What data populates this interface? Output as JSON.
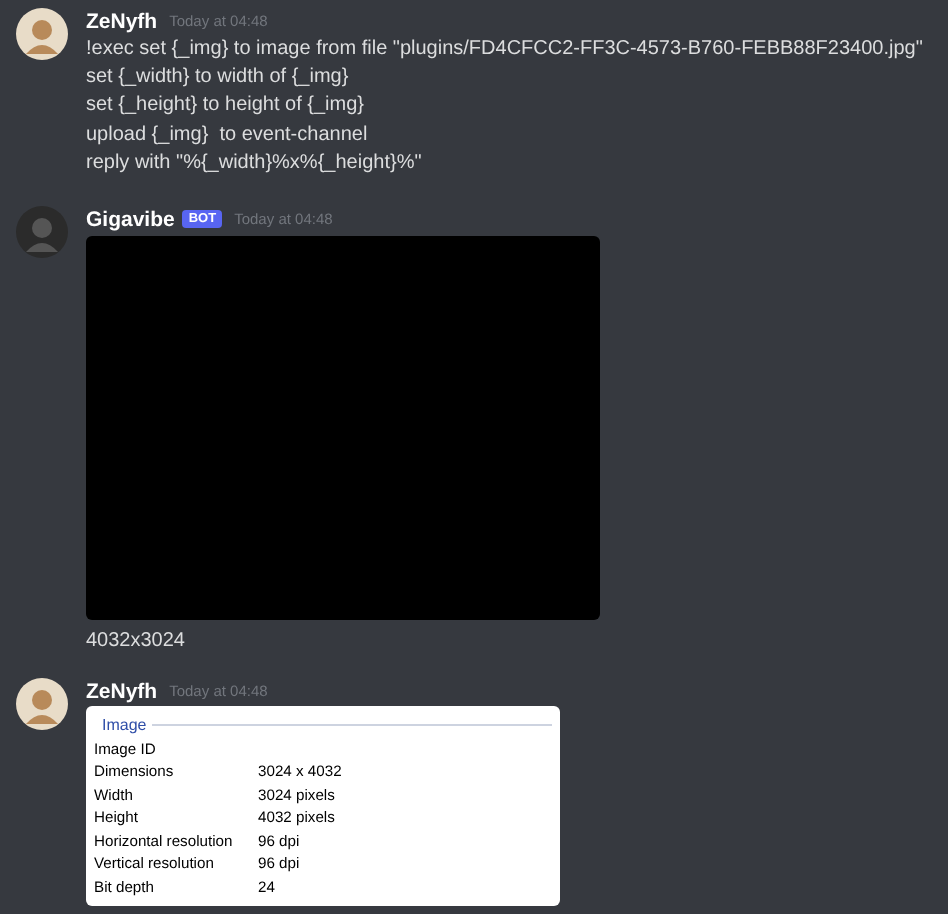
{
  "messages": [
    {
      "kind": "text",
      "author": "ZeNyfh",
      "bot": false,
      "time": "Today at 04:48",
      "lines": [
        "!exec set {_img} to image from file \"plugins/FD4CFCC2-FF3C-4573-B760-FEBB88F23400.jpg\"",
        "set {_width} to width of {_img}",
        "set {_height} to height of {_img}",
        "upload {_img}  to event-channel",
        "reply with \"%{_width}%x%{_height}%\""
      ]
    },
    {
      "author": "Gigavibe",
      "bot": true,
      "badge": "BOT",
      "time": "Today at 04:48",
      "lines": [
        "4032x3024"
      ]
    },
    {
      "kind": "embed",
      "author": "ZeNyfh",
      "bot": false,
      "time": "Today at 04:48",
      "embed": {
        "legend": "Image",
        "rows": [
          {
            "label": "Image ID"
          },
          {
            "label": "Dimensions",
            "value": "3024 x 4032"
          },
          {
            "label": "Width",
            "value": "3024 pixels"
          },
          {
            "label": "Height",
            "value": "4032 pixels"
          },
          {
            "label": "Horizontal resolution",
            "value": "96 dpi"
          },
          {
            "label": "Vertical resolution",
            "value": "96 dpi"
          },
          {
            "label": "Bit depth",
            "value": "24"
          }
        ]
      }
    }
  ]
}
